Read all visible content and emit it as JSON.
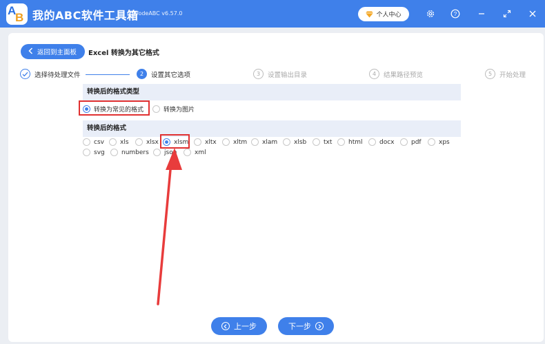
{
  "app": {
    "title": "我的ABC软件工具箱",
    "version": "WodeABC v6.57.0",
    "logo_text_1": "A",
    "logo_text_2": "B"
  },
  "titlebar": {
    "user_center": "个人中心",
    "icons": [
      "settings-icon",
      "help-icon",
      "minimize-icon",
      "maximize-icon",
      "close-icon"
    ]
  },
  "header": {
    "back_label": "返回到主面板",
    "page_title": "Excel 转换为其它格式"
  },
  "steps": [
    {
      "num": "1",
      "label": "选择待处理文件",
      "state": "done"
    },
    {
      "num": "2",
      "label": "设置其它选项",
      "state": "active"
    },
    {
      "num": "3",
      "label": "设置输出目录",
      "state": "pending"
    },
    {
      "num": "4",
      "label": "结果路径预览",
      "state": "pending"
    },
    {
      "num": "5",
      "label": "开始处理",
      "state": "pending"
    }
  ],
  "type_section": {
    "title": "转换后的格式类型",
    "options": [
      "转换为常见的格式",
      "转换为图片"
    ],
    "selected": "转换为常见的格式"
  },
  "format_section": {
    "title": "转换后的格式",
    "row1": [
      "csv",
      "xls",
      "xlsx",
      "xlsm",
      "xltx",
      "xltm",
      "xlam",
      "xlsb",
      "txt",
      "html",
      "docx",
      "pdf",
      "xps"
    ],
    "row2": [
      "svg",
      "numbers",
      "json",
      "xml"
    ],
    "selected": "xlsm"
  },
  "footer": {
    "prev_label": "上一步",
    "next_label": "下一步"
  },
  "colors": {
    "primary": "#3f80ea",
    "highlight": "#e03030",
    "section_bg": "#e9eef8"
  }
}
